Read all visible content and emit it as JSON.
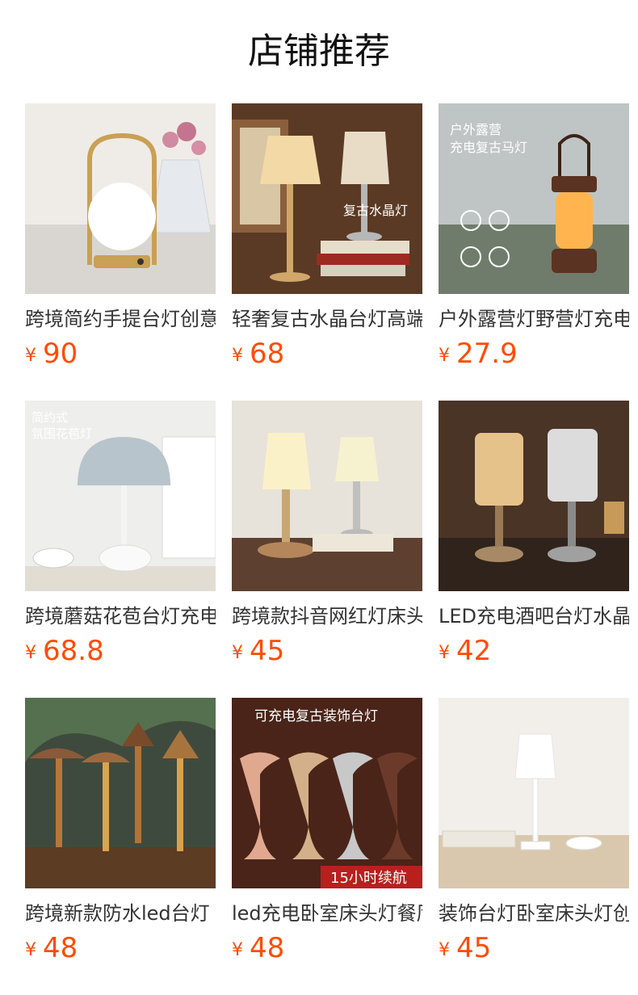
{
  "page": {
    "title": "店铺推荐"
  },
  "products": [
    {
      "title": "跨境简约手提台灯创意",
      "currency": "¥",
      "price": "90",
      "image_icon": "lamp-photo-icon",
      "overlay": []
    },
    {
      "title": "轻奢复古水晶台灯高端",
      "currency": "¥",
      "price": "68",
      "image_icon": "lamp-photo-icon",
      "overlay": [
        "复古水晶灯"
      ]
    },
    {
      "title": "户外露营灯野营灯充电",
      "currency": "¥",
      "price": "27.9",
      "image_icon": "lamp-photo-icon",
      "overlay": [
        "户外露营",
        "充电复古马灯"
      ]
    },
    {
      "title": "跨境蘑菇花苞台灯充电",
      "currency": "¥",
      "price": "68.8",
      "image_icon": "lamp-photo-icon",
      "overlay": [
        "简约式",
        "氛围花苞灯"
      ]
    },
    {
      "title": "跨境款抖音网红灯床头",
      "currency": "¥",
      "price": "45",
      "image_icon": "lamp-photo-icon",
      "overlay": []
    },
    {
      "title": "LED充电酒吧台灯水晶",
      "currency": "¥",
      "price": "42",
      "image_icon": "lamp-photo-icon",
      "overlay": []
    },
    {
      "title": "跨境新款防水led台灯",
      "currency": "¥",
      "price": "48",
      "image_icon": "lamp-photo-icon",
      "overlay": []
    },
    {
      "title": "led充电卧室床头灯餐厅",
      "currency": "¥",
      "price": "48",
      "image_icon": "lamp-photo-icon",
      "overlay": [
        "可充电复古装饰台灯",
        "15小时续航"
      ]
    },
    {
      "title": "装饰台灯卧室床头灯创意",
      "currency": "¥",
      "price": "45",
      "image_icon": "lamp-photo-icon",
      "overlay": []
    }
  ],
  "colors": {
    "price": "#ff4c00",
    "title": "#111111",
    "text": "#333333"
  }
}
